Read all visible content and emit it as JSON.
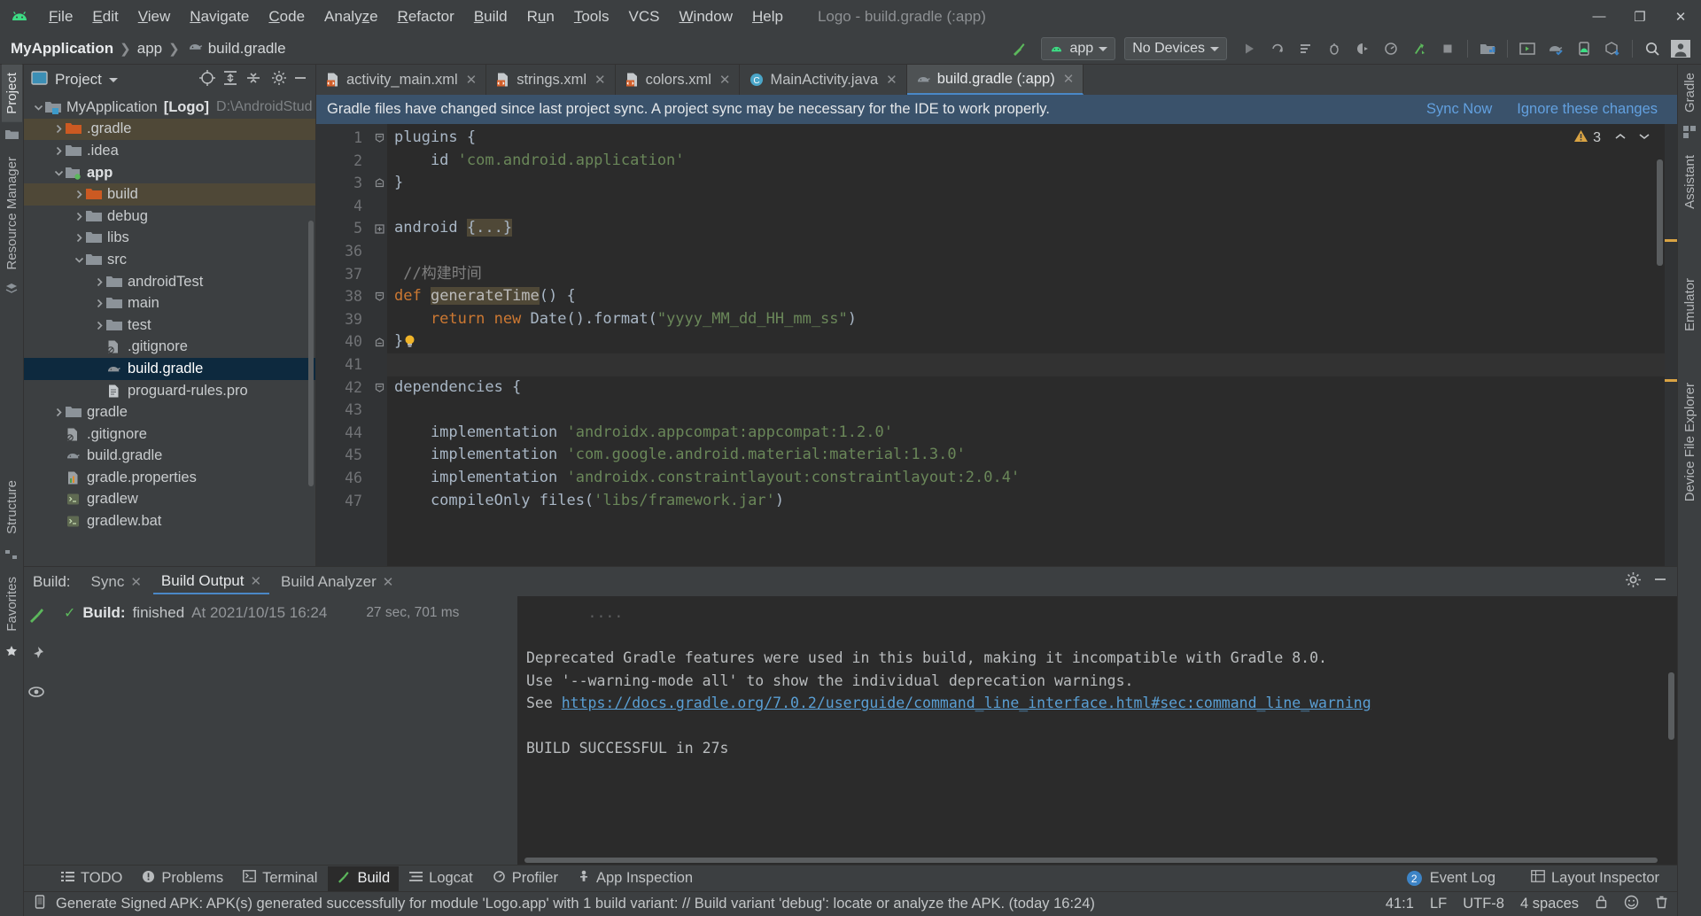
{
  "menubar": {
    "items": [
      "File",
      "Edit",
      "View",
      "Navigate",
      "Code",
      "Analyze",
      "Refactor",
      "Build",
      "Run",
      "Tools",
      "VCS",
      "Window",
      "Help"
    ],
    "window_title": "Logo - build.gradle (:app)",
    "minimize": "—",
    "maximize": "❐",
    "close": "✕"
  },
  "navbar": {
    "crumbs": [
      "MyApplication",
      "app",
      "build.gradle"
    ],
    "module_combo": "app",
    "device_combo": "No Devices"
  },
  "project": {
    "title": "Project",
    "tree": [
      {
        "indent": 0,
        "arrow": "down",
        "icon": "module-folder",
        "label": "MyApplication",
        "suffix": "[Logo]",
        "path": "D:\\AndroidStud",
        "bold": false,
        "state": "normal"
      },
      {
        "indent": 1,
        "arrow": "right",
        "icon": "folder-orange",
        "label": ".gradle",
        "state": "highlight"
      },
      {
        "indent": 1,
        "arrow": "right",
        "icon": "folder",
        "label": ".idea",
        "state": "normal"
      },
      {
        "indent": 1,
        "arrow": "down",
        "icon": "module-folder-green",
        "label": "app",
        "bold": true,
        "state": "normal"
      },
      {
        "indent": 2,
        "arrow": "right",
        "icon": "folder-orange",
        "label": "build",
        "state": "highlight"
      },
      {
        "indent": 2,
        "arrow": "right",
        "icon": "folder",
        "label": "debug",
        "state": "normal"
      },
      {
        "indent": 2,
        "arrow": "right",
        "icon": "folder",
        "label": "libs",
        "state": "normal"
      },
      {
        "indent": 2,
        "arrow": "down",
        "icon": "folder",
        "label": "src",
        "state": "normal"
      },
      {
        "indent": 3,
        "arrow": "right",
        "icon": "folder",
        "label": "androidTest",
        "state": "normal"
      },
      {
        "indent": 3,
        "arrow": "right",
        "icon": "folder",
        "label": "main",
        "state": "normal"
      },
      {
        "indent": 3,
        "arrow": "right",
        "icon": "folder",
        "label": "test",
        "state": "normal"
      },
      {
        "indent": 3,
        "arrow": "none",
        "icon": "gitignore-file",
        "label": ".gitignore",
        "state": "normal"
      },
      {
        "indent": 3,
        "arrow": "none",
        "icon": "gradle-file",
        "label": "build.gradle",
        "state": "selected"
      },
      {
        "indent": 3,
        "arrow": "none",
        "icon": "text-file",
        "label": "proguard-rules.pro",
        "state": "normal"
      },
      {
        "indent": 1,
        "arrow": "right",
        "icon": "folder",
        "label": "gradle",
        "state": "normal"
      },
      {
        "indent": 1,
        "arrow": "none",
        "icon": "gitignore-file",
        "label": ".gitignore",
        "state": "normal"
      },
      {
        "indent": 1,
        "arrow": "none",
        "icon": "gradle-file",
        "label": "build.gradle",
        "state": "normal"
      },
      {
        "indent": 1,
        "arrow": "none",
        "icon": "properties-file",
        "label": "gradle.properties",
        "state": "normal"
      },
      {
        "indent": 1,
        "arrow": "none",
        "icon": "script-file",
        "label": "gradlew",
        "state": "normal"
      },
      {
        "indent": 1,
        "arrow": "none",
        "icon": "script-file",
        "label": "gradlew.bat",
        "state": "normal"
      }
    ]
  },
  "left_strip": {
    "tabs": [
      "Project",
      "Resource Manager",
      "Structure",
      "Favorites"
    ]
  },
  "right_strip": {
    "tabs": [
      "Gradle",
      "Assistant",
      "Emulator",
      "Device File Explorer"
    ]
  },
  "editor": {
    "tabs": [
      {
        "label": "activity_main.xml",
        "icon": "xml-file",
        "active": false
      },
      {
        "label": "strings.xml",
        "icon": "xml-file",
        "active": false
      },
      {
        "label": "colors.xml",
        "icon": "xml-file",
        "active": false
      },
      {
        "label": "MainActivity.java",
        "icon": "java-class",
        "active": false
      },
      {
        "label": "build.gradle (:app)",
        "icon": "gradle-file",
        "active": true
      }
    ],
    "notification": {
      "message": "Gradle files have changed since last project sync. A project sync may be necessary for the IDE to work properly.",
      "sync_link": "Sync Now",
      "ignore_link": "Ignore these changes"
    },
    "warning_count": "3",
    "lines": [
      {
        "num": "1",
        "fold": "open",
        "tokens": [
          {
            "t": "plugins {",
            "c": "pl"
          }
        ]
      },
      {
        "num": "2",
        "fold": "none",
        "tokens": [
          {
            "t": "    id ",
            "c": "pl"
          },
          {
            "t": "'com.android.application'",
            "c": "s"
          }
        ]
      },
      {
        "num": "3",
        "fold": "close",
        "tokens": [
          {
            "t": "}",
            "c": "pl"
          }
        ]
      },
      {
        "num": "4",
        "fold": "none",
        "tokens": [
          {
            "t": "",
            "c": "pl"
          }
        ]
      },
      {
        "num": "5",
        "fold": "plus",
        "tokens": [
          {
            "t": "android ",
            "c": "pl"
          },
          {
            "t": "{...}",
            "c": "hl"
          }
        ]
      },
      {
        "num": "36",
        "fold": "none",
        "tokens": [
          {
            "t": "",
            "c": "pl"
          }
        ]
      },
      {
        "num": "37",
        "fold": "none",
        "tokens": [
          {
            "t": " //构建时间",
            "c": "cm"
          }
        ]
      },
      {
        "num": "38",
        "fold": "open",
        "tokens": [
          {
            "t": "def ",
            "c": "k"
          },
          {
            "t": "generateTime",
            "c": "hlw"
          },
          {
            "t": "() {",
            "c": "pl"
          }
        ]
      },
      {
        "num": "39",
        "fold": "none",
        "tokens": [
          {
            "t": "    return new ",
            "c": "k"
          },
          {
            "t": "Date().format(",
            "c": "pl"
          },
          {
            "t": "\"yyyy_MM_dd_HH_mm_ss\"",
            "c": "s"
          },
          {
            "t": ")",
            "c": "pl"
          }
        ]
      },
      {
        "num": "40",
        "fold": "close",
        "tokens": [
          {
            "t": "}",
            "c": "pl"
          },
          {
            "t": "💡",
            "c": "bulb"
          }
        ]
      },
      {
        "num": "41",
        "fold": "none",
        "current": true,
        "tokens": [
          {
            "t": "",
            "c": "pl"
          }
        ]
      },
      {
        "num": "42",
        "fold": "open",
        "tokens": [
          {
            "t": "dependencies {",
            "c": "pl"
          }
        ]
      },
      {
        "num": "43",
        "fold": "none",
        "tokens": [
          {
            "t": "",
            "c": "pl"
          }
        ]
      },
      {
        "num": "44",
        "fold": "none",
        "tokens": [
          {
            "t": "    implementation ",
            "c": "pl"
          },
          {
            "t": "'androidx.appcompat:appcompat:1.2.0'",
            "c": "s"
          }
        ]
      },
      {
        "num": "45",
        "fold": "none",
        "tokens": [
          {
            "t": "    implementation ",
            "c": "pl"
          },
          {
            "t": "'com.google.android.material:material:1.3.0'",
            "c": "s"
          }
        ]
      },
      {
        "num": "46",
        "fold": "none",
        "tokens": [
          {
            "t": "    implementation ",
            "c": "pl"
          },
          {
            "t": "'androidx.constraintlayout:constraintlayout:2.0.4'",
            "c": "s"
          }
        ]
      },
      {
        "num": "47",
        "fold": "none",
        "tokens": [
          {
            "t": "    compileOnly files(",
            "c": "pl"
          },
          {
            "t": "'libs/framework.jar'",
            "c": "s"
          },
          {
            "t": ")",
            "c": "pl"
          }
        ]
      }
    ]
  },
  "build_panel": {
    "label": "Build:",
    "tabs": [
      {
        "label": "Sync",
        "active": false,
        "closable": true
      },
      {
        "label": "Build Output",
        "active": true,
        "closable": true
      },
      {
        "label": "Build Analyzer",
        "active": false,
        "closable": true
      }
    ],
    "tree_row": {
      "title": "Build:",
      "status": "finished",
      "at": "At 2021/10/15 16:24",
      "duration": "27 sec, 701 ms"
    },
    "log": [
      "Deprecated Gradle features were used in this build, making it incompatible with Gradle 8.0.",
      "Use '--warning-mode all' to show the individual deprecation warnings.",
      "BUILD SUCCESSFUL in 27s"
    ],
    "log_see_prefix": "See ",
    "log_link": "https://docs.gradle.org/7.0.2/userguide/command_line_interface.html#sec:command_line_warning"
  },
  "bottom_tabs": {
    "items": [
      {
        "label": "TODO",
        "icon": "list-icon",
        "active": false
      },
      {
        "label": "Problems",
        "icon": "exclamation-icon",
        "active": false
      },
      {
        "label": "Terminal",
        "icon": "terminal-icon",
        "active": false
      },
      {
        "label": "Build",
        "icon": "hammer-icon",
        "active": true
      },
      {
        "label": "Logcat",
        "icon": "logcat-icon",
        "active": false
      },
      {
        "label": "Profiler",
        "icon": "profiler-icon",
        "active": false
      },
      {
        "label": "App Inspection",
        "icon": "inspection-icon",
        "active": false
      }
    ],
    "event_log": "Event Log",
    "event_count": "2",
    "layout_inspector": "Layout Inspector"
  },
  "status_bar": {
    "message": "Generate Signed APK: APK(s) generated successfully for module 'Logo.app' with 1 build variant: // Build variant 'debug': locate or analyze the APK. (today 16:24)",
    "caret": "41:1",
    "line_sep": "LF",
    "encoding": "UTF-8",
    "indent": "4 spaces"
  }
}
